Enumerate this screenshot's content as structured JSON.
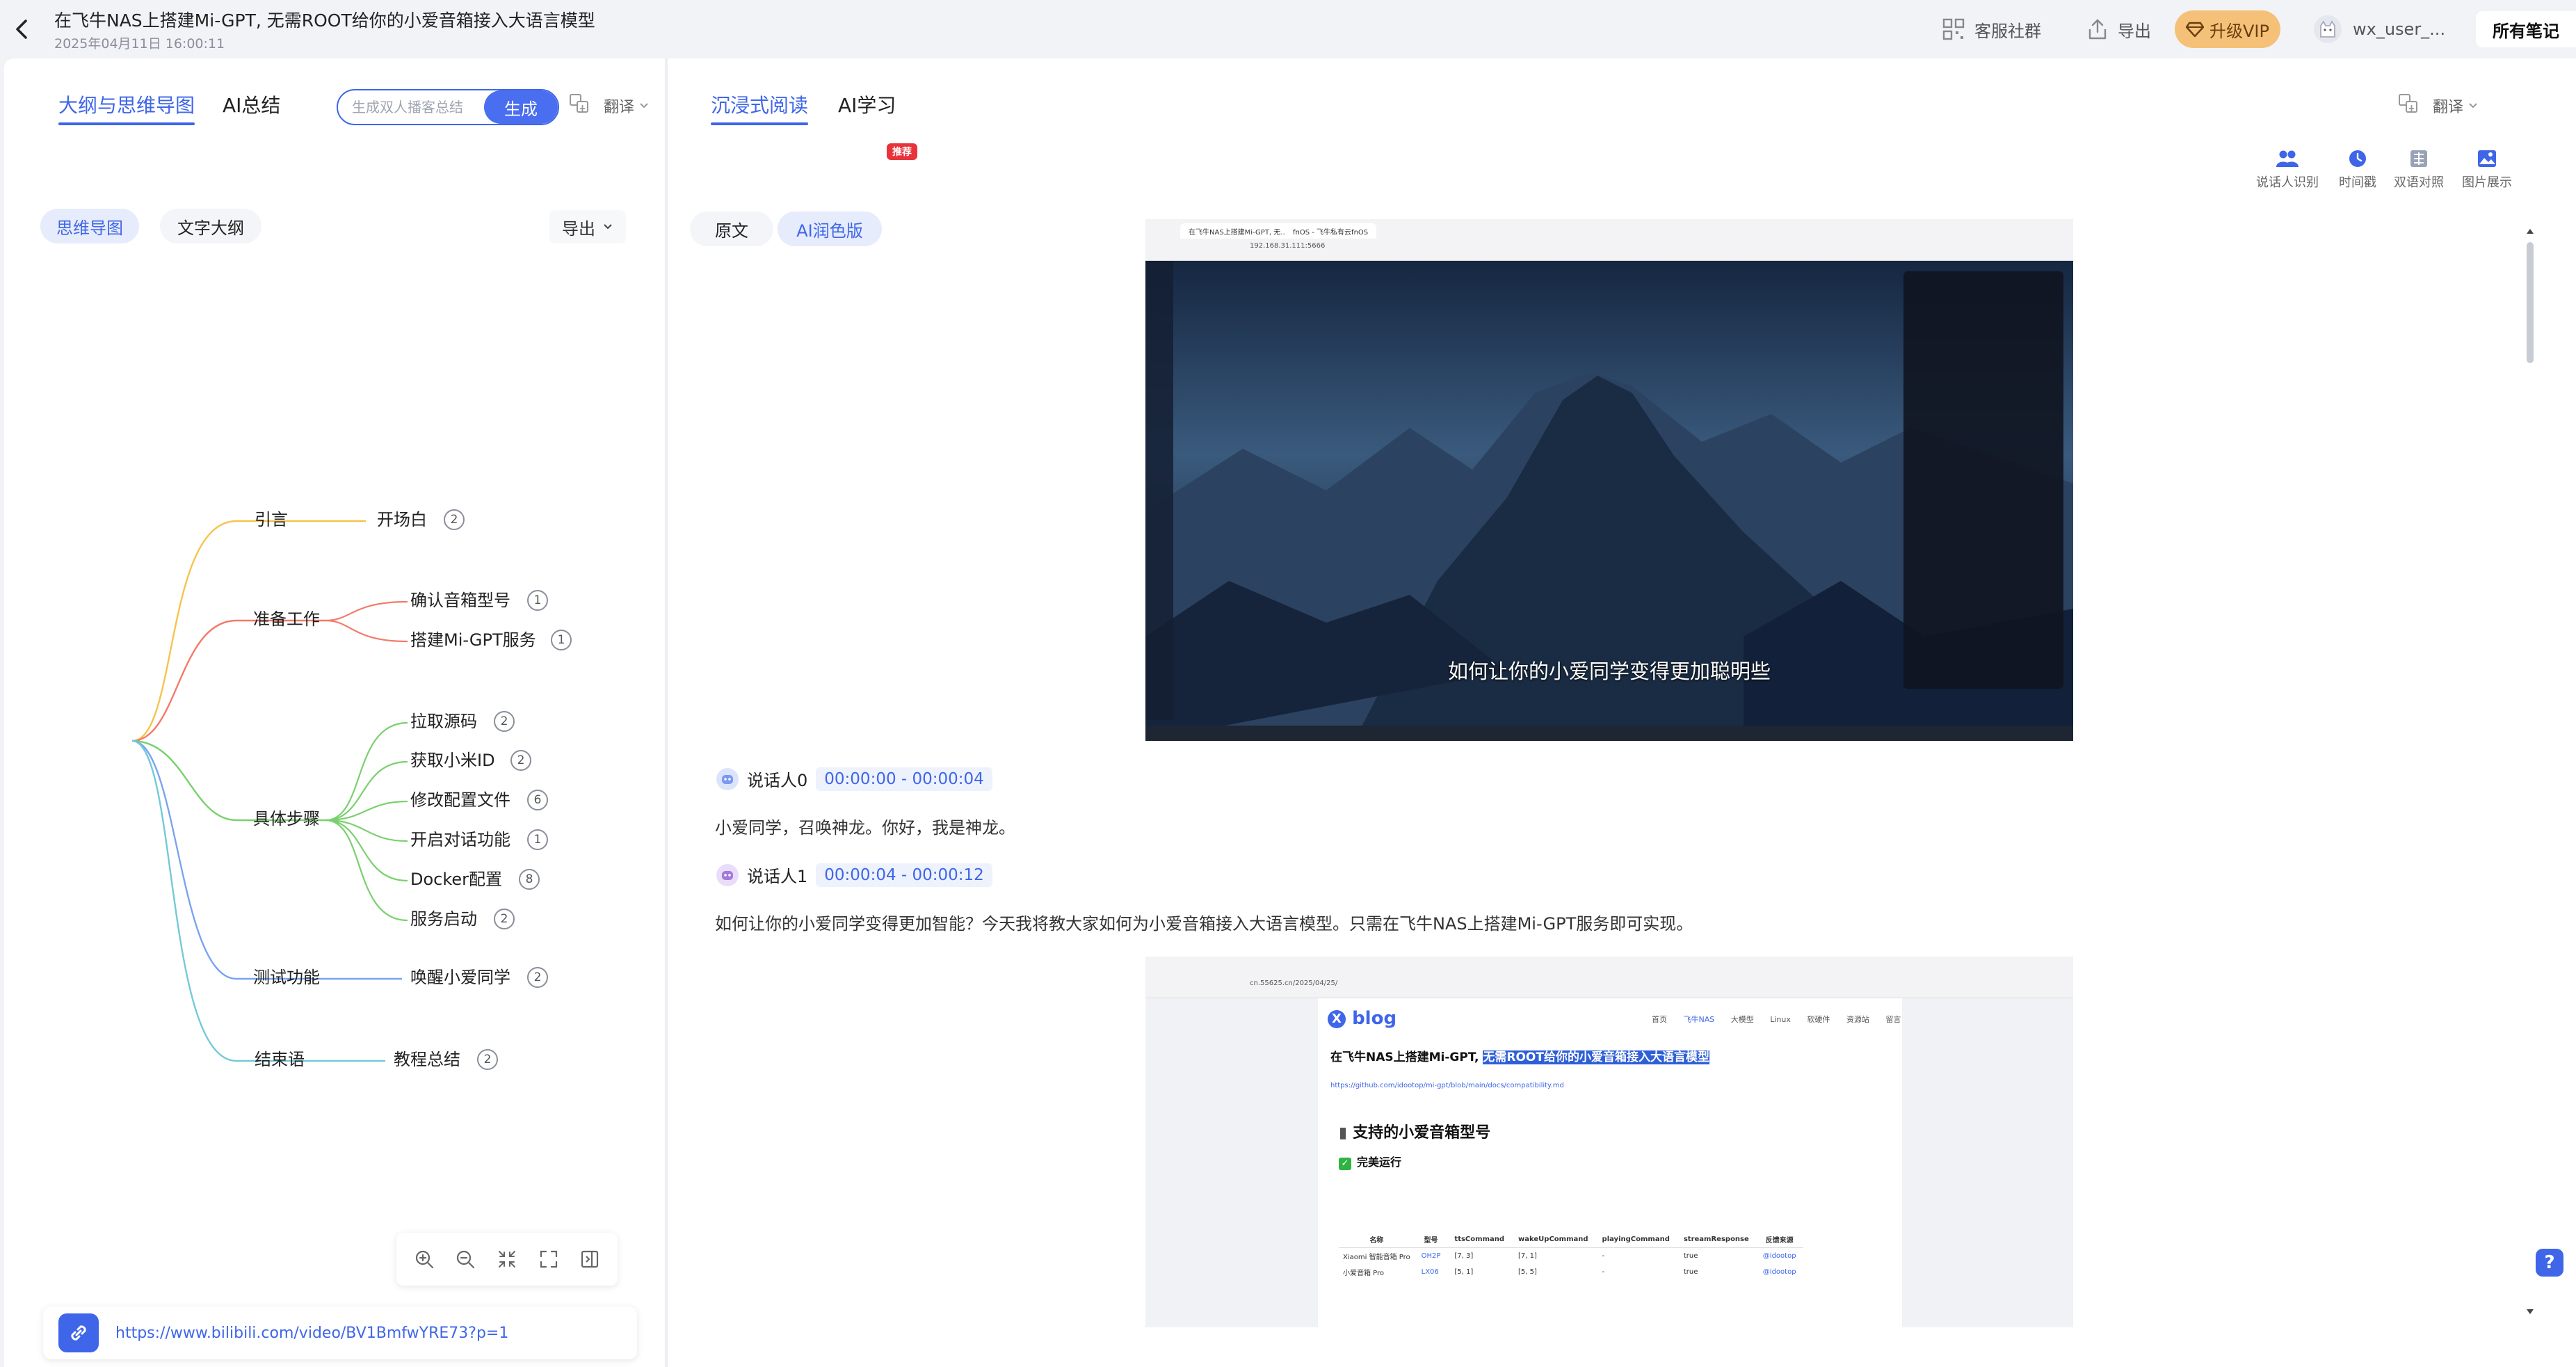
{
  "header": {
    "title": "在飞牛NAS上搭建Mi-GPT, 无需ROOT给你的小爱音箱接入大语言模型",
    "date": "2025年04月11日 16:00:11",
    "actions": {
      "community": "客服社群",
      "export": "导出",
      "vip": "升级VIP",
      "user": "wx_user_...",
      "all_notes": "所有笔记"
    }
  },
  "left": {
    "tabs": [
      "大纲与思维导图",
      "AI总结"
    ],
    "generate": {
      "placeholder": "生成双人播客总结",
      "button": "生成"
    },
    "translate": "翻译",
    "view_toggle": [
      "思维导图",
      "文字大纲"
    ],
    "export": "导出",
    "mindmap": {
      "branches": [
        {
          "label": "引言",
          "children": [
            {
              "label": "开场白",
              "count": "2"
            }
          ]
        },
        {
          "label": "准备工作",
          "children": [
            {
              "label": "确认音箱型号",
              "count": "1"
            },
            {
              "label": "搭建Mi-GPT服务",
              "count": "1"
            }
          ]
        },
        {
          "label": "具体步骤",
          "children": [
            {
              "label": "拉取源码",
              "count": "2"
            },
            {
              "label": "获取小米ID",
              "count": "2"
            },
            {
              "label": "修改配置文件",
              "count": "6"
            },
            {
              "label": "开启对话功能",
              "count": "1"
            },
            {
              "label": "Docker配置",
              "count": "8"
            },
            {
              "label": "服务启动",
              "count": "2"
            }
          ]
        },
        {
          "label": "测试功能",
          "children": [
            {
              "label": "唤醒小爱同学",
              "count": "2"
            }
          ]
        },
        {
          "label": "结束语",
          "children": [
            {
              "label": "教程总结",
              "count": "2"
            }
          ]
        }
      ]
    },
    "source_url": "https://www.bilibili.com/video/BV1BmfwYRE73?p=1"
  },
  "right": {
    "tabs": [
      "沉浸式阅读",
      "AI学习"
    ],
    "translate": "翻译",
    "mode_toggle": [
      "原文",
      "AI润色版"
    ],
    "badge": "推荐",
    "tools": [
      "说话人识别",
      "时间戳",
      "双语对照",
      "图片展示"
    ],
    "screenshot1": {
      "tab1": "在飞牛NAS上搭建Mi-GPT, 无...",
      "tab2": "fnOS - 飞牛私有云fnOS",
      "url": "192.168.31.111:5666",
      "subtitle": "如何让你的小爱同学变得更加聪明些"
    },
    "screenshot2": {
      "url": "cn.55625.cn/2025/04/25/",
      "blog_logo": "blog",
      "blog_title_plain": "在飞牛NAS上搭建Mi-GPT, ",
      "blog_title_highlight": "无需ROOT给你的小爱音箱接入大语言模型",
      "nav": [
        "首页",
        "飞牛NAS",
        "大模型",
        "Linux",
        "软硬件",
        "资源站",
        "留言"
      ],
      "link": "https://github.com/idootop/mi-gpt/blob/main/docs/compatibility.md",
      "heading": "支持的小爱音箱型号",
      "subheading": "完美运行",
      "table_headers": [
        "名称",
        "型号",
        "ttsCommand",
        "wakeUpCommand",
        "playingCommand",
        "streamResponse",
        "反馈来源"
      ],
      "table_rows": [
        [
          "Xiaomi 智能音箱 Pro",
          "OH2P",
          "[7, 3]",
          "[7, 1]",
          "-",
          "true",
          "@idootop"
        ],
        [
          "小爱音箱 Pro",
          "LX06",
          "[5, 1]",
          "[5, 5]",
          "-",
          "true",
          "@idootop"
        ]
      ]
    },
    "segments": [
      {
        "speaker": "说话人0",
        "time": "00:00:00 - 00:00:04",
        "text": "小爱同学，召唤神龙。你好，我是神龙。"
      },
      {
        "speaker": "说话人1",
        "time": "00:00:04 - 00:00:12",
        "text": "如何让你的小爱同学变得更加智能？今天我将教大家如何为小爱音箱接入大语言模型。只需在飞牛NAS上搭建Mi-GPT服务即可实现。"
      }
    ]
  },
  "colors": {
    "accent": "#3f66e8",
    "vip": "#f5c178",
    "badge": "#e8333a"
  }
}
